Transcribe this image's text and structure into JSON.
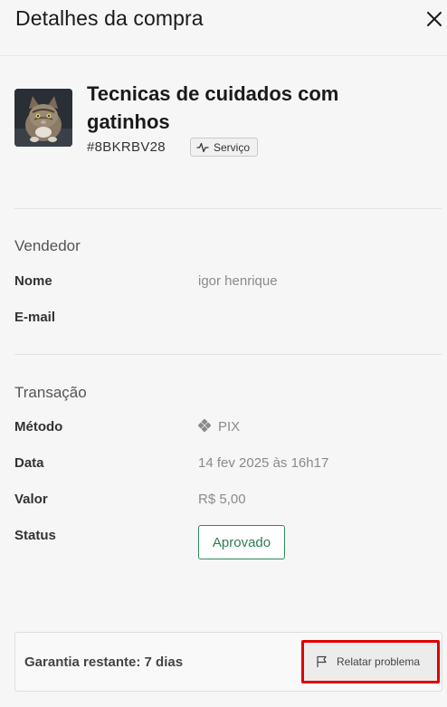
{
  "header": {
    "title": "Detalhes da compra"
  },
  "product": {
    "title": "Tecnicas de cuidados com gatinhos",
    "code": "#8BKRBV28",
    "badge_label": "Serviço"
  },
  "seller": {
    "section_title": "Vendedor",
    "name_label": "Nome",
    "name_value": "igor henrique",
    "email_label": "E-mail",
    "email_value": ""
  },
  "transaction": {
    "section_title": "Transação",
    "method_label": "Método",
    "method_value": "PIX",
    "date_label": "Data",
    "date_value": "14 fev 2025 às 16h17",
    "amount_label": "Valor",
    "amount_value": "R$ 5,00",
    "status_label": "Status",
    "status_value": "Aprovado",
    "status_color": "#2e8b57"
  },
  "footer": {
    "warranty_text": "Garantia restante: 7 dias",
    "report_label": "Relatar problema",
    "highlight_color": "#e00000"
  },
  "icons": {
    "close": "close-icon",
    "badge": "activity-icon",
    "method": "pix-icon",
    "report": "flag-icon"
  }
}
